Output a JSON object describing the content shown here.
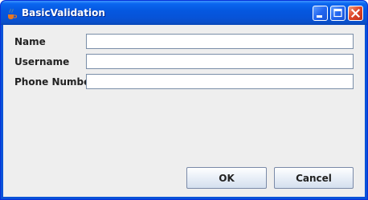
{
  "window": {
    "title": "BasicValidation",
    "controls": {
      "minimize_icon": "minimize-icon",
      "maximize_icon": "maximize-icon",
      "close_icon": "close-icon"
    }
  },
  "form": {
    "fields": [
      {
        "label": "Name",
        "value": ""
      },
      {
        "label": "Username",
        "value": ""
      },
      {
        "label": "Phone Number",
        "value": ""
      }
    ]
  },
  "buttons": {
    "ok_label": "OK",
    "cancel_label": "Cancel"
  },
  "colors": {
    "titlebar": "#0558e0",
    "content_bg": "#eeeeee",
    "close_button": "#e0482a"
  }
}
